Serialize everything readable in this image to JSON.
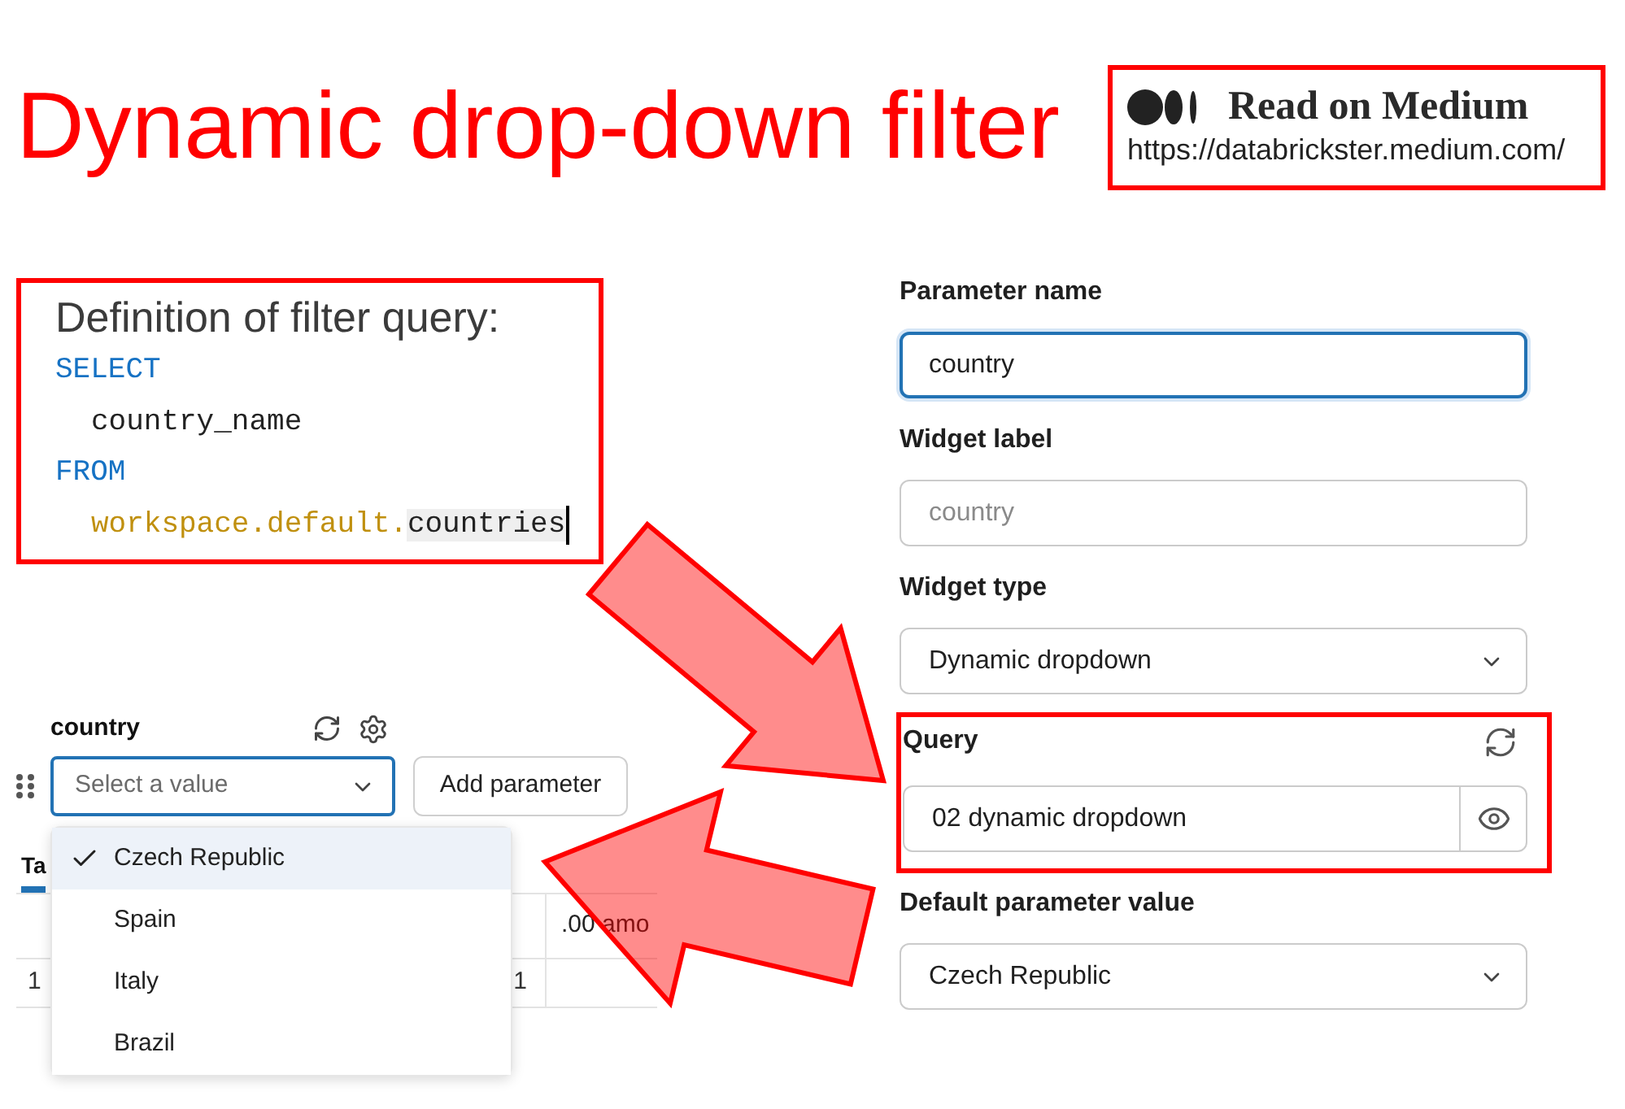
{
  "title": "Dynamic drop-down filter",
  "banner": {
    "heading": "Read on Medium",
    "url": "https://databrickster.medium.com/"
  },
  "code_card": {
    "title": "Definition of filter query:",
    "lines": [
      {
        "cursor": false,
        "tokens": [
          {
            "text": "SELECT",
            "kind": "keyword"
          }
        ],
        "children": [
          {
            "cursor": false,
            "tokens": [
              {
                "text": "country_name",
                "kind": "plain"
              }
            ]
          }
        ]
      },
      {
        "cursor": false,
        "tokens": [
          {
            "text": "FROM",
            "kind": "keyword"
          }
        ],
        "children": [
          {
            "cursor": true,
            "tokens": [
              {
                "text": "workspace.default.",
                "kind": "path"
              },
              {
                "text": "countries",
                "kind": "highlighted"
              }
            ]
          }
        ]
      }
    ]
  },
  "widget": {
    "label": "country",
    "select": {
      "placeholder": "Select a value",
      "focused": true
    },
    "button": "Add parameter",
    "options": [
      {
        "label": "Czech Republic",
        "selected": true
      },
      {
        "label": "Spain",
        "selected": false
      },
      {
        "label": "Italy",
        "selected": false
      },
      {
        "label": "Brazil",
        "selected": false
      }
    ]
  },
  "table": {
    "tabs": [
      {
        "label": "Ta",
        "selected": true
      }
    ],
    "columns": [
      ".00 amo"
    ],
    "rows": [
      {
        "number": "1",
        "cells": [
          "1"
        ]
      }
    ]
  },
  "form": {
    "fields": [
      {
        "label": "Parameter name",
        "kind": "input",
        "value": "country",
        "focused": true,
        "highlighted": false
      },
      {
        "label": "Widget label",
        "kind": "input",
        "placeholder": "country",
        "focused": false,
        "highlighted": false
      },
      {
        "label": "Widget type",
        "kind": "select",
        "value": "Dynamic dropdown",
        "focused": false,
        "highlighted": false
      },
      {
        "label": "Query",
        "kind": "query",
        "value": "02 dynamic dropdown",
        "focused": false,
        "highlighted": true
      },
      {
        "label": "Default parameter value",
        "kind": "select",
        "value": "Czech Republic",
        "focused": false,
        "highlighted": false
      }
    ]
  }
}
